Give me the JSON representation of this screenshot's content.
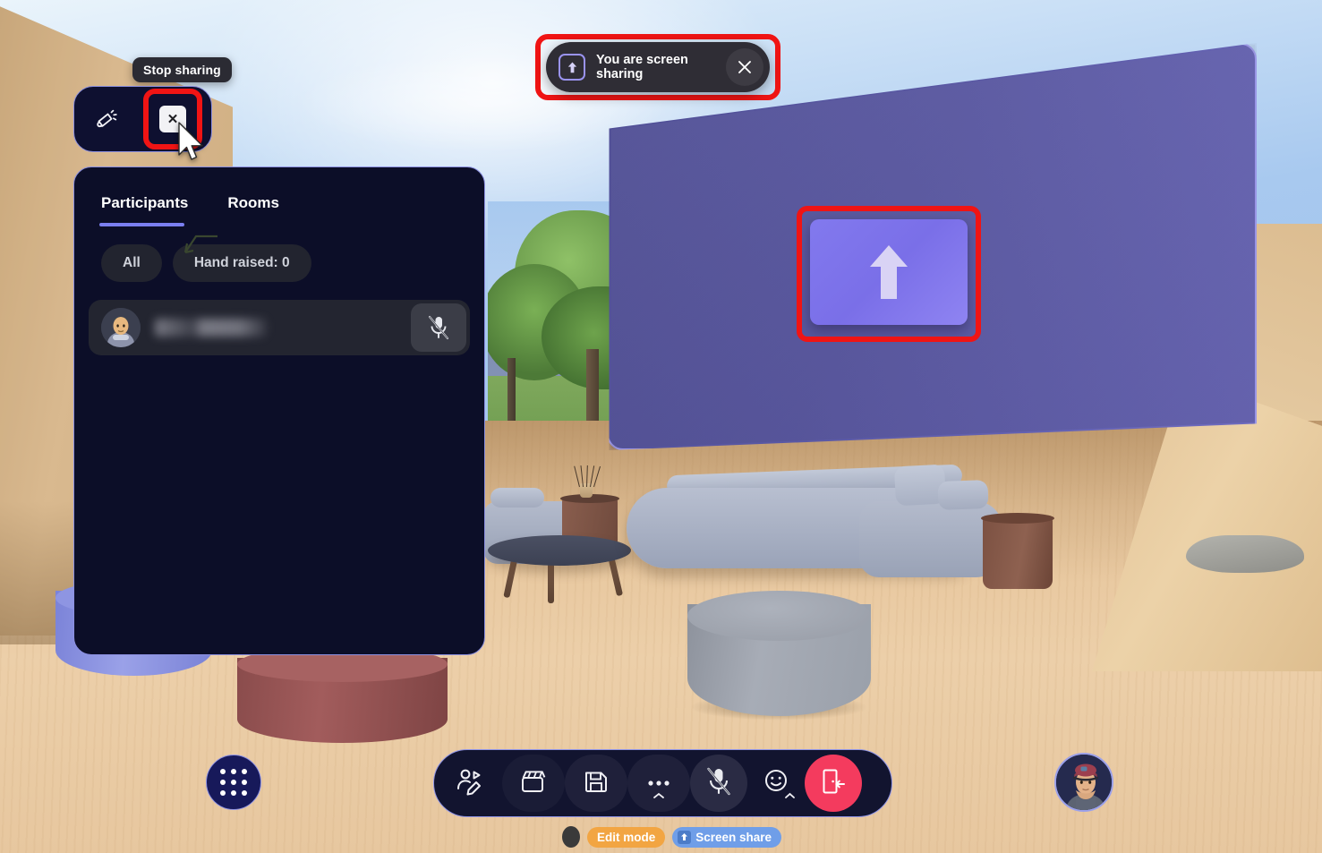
{
  "tooltip": {
    "text": "Stop sharing"
  },
  "mini_bar": {
    "announce_icon": "megaphone-icon",
    "close_label": "✕"
  },
  "share_banner": {
    "icon": "screen-share-up-icon",
    "text": "You are screen sharing",
    "close_label": "✕"
  },
  "panel": {
    "tabs": [
      {
        "label": "Participants",
        "active": true
      },
      {
        "label": "Rooms",
        "active": false
      }
    ],
    "filters": [
      {
        "label": "All"
      },
      {
        "label": "Hand raised: 0"
      }
    ],
    "participants": [
      {
        "name": "",
        "name_redacted": true,
        "mic_icon": "mic-off-icon"
      }
    ]
  },
  "big_screen": {
    "tile_icon": "screen-share-arrow-up-icon"
  },
  "grid_button": {
    "icon": "apps-grid-icon"
  },
  "toolbar": {
    "buttons": [
      {
        "label": "",
        "icon": "avatar-edit-icon",
        "name": "customize-avatar-button"
      },
      {
        "label": "",
        "icon": "clapperboard-icon",
        "name": "record-button"
      },
      {
        "label": "",
        "icon": "floppy-save-icon",
        "name": "save-button"
      },
      {
        "label": "",
        "icon": "more-dots-icon",
        "name": "more-options-button"
      },
      {
        "label": "",
        "icon": "mic-off-icon",
        "name": "microphone-button"
      },
      {
        "label": "",
        "icon": "emoji-smile-icon",
        "name": "reactions-button"
      },
      {
        "label": "",
        "icon": "leave-door-icon",
        "name": "leave-button"
      }
    ]
  },
  "self_avatar": {
    "alt": "self-avatar"
  },
  "status_strip": {
    "edit_mode_label": "Edit mode",
    "screen_share_label": "Screen share",
    "screen_share_icon": "up-arrow-icon"
  },
  "colors": {
    "accent_purple": "#8b8fe0",
    "tab_underline": "#7b7ff0",
    "highlight_red": "#f01414",
    "leave_red": "#f43b5e",
    "edit_mode_orange": "#f2a542",
    "screen_share_blue": "#6f9ee8",
    "panel_bg": "#0c0e28",
    "banner_bg": "#2f2d35"
  }
}
